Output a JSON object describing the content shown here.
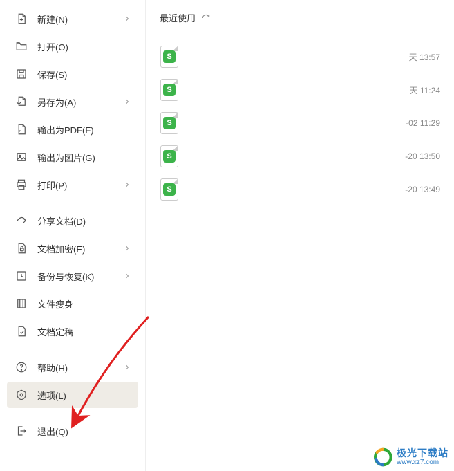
{
  "sidebar": {
    "items": [
      {
        "id": "new",
        "label": "新建(N)",
        "icon": "new-file-icon",
        "chevron": true
      },
      {
        "id": "open",
        "label": "打开(O)",
        "icon": "folder-open-icon",
        "chevron": false
      },
      {
        "id": "save",
        "label": "保存(S)",
        "icon": "save-icon",
        "chevron": false
      },
      {
        "id": "saveas",
        "label": "另存为(A)",
        "icon": "save-as-icon",
        "chevron": true
      },
      {
        "id": "exportpdf",
        "label": "输出为PDF(F)",
        "icon": "export-pdf-icon",
        "chevron": false
      },
      {
        "id": "exportimg",
        "label": "输出为图片(G)",
        "icon": "export-image-icon",
        "chevron": false
      },
      {
        "id": "print",
        "label": "打印(P)",
        "icon": "print-icon",
        "chevron": true
      },
      {
        "id": "share",
        "label": "分享文档(D)",
        "icon": "share-icon",
        "chevron": false
      },
      {
        "id": "encrypt",
        "label": "文档加密(E)",
        "icon": "lock-icon",
        "chevron": true
      },
      {
        "id": "backup",
        "label": "备份与恢复(K)",
        "icon": "backup-icon",
        "chevron": true
      },
      {
        "id": "slim",
        "label": "文件瘦身",
        "icon": "slim-icon",
        "chevron": false
      },
      {
        "id": "finalize",
        "label": "文档定稿",
        "icon": "finalize-icon",
        "chevron": false
      },
      {
        "id": "help",
        "label": "帮助(H)",
        "icon": "help-icon",
        "chevron": true
      },
      {
        "id": "options",
        "label": "选项(L)",
        "icon": "options-icon",
        "chevron": false,
        "selected": true
      },
      {
        "id": "exit",
        "label": "退出(Q)",
        "icon": "exit-icon",
        "chevron": false
      }
    ]
  },
  "recent": {
    "title": "最近使用",
    "files": [
      {
        "badge": "S",
        "time_suffix": "天 13:57"
      },
      {
        "badge": "S",
        "time_suffix": "天 11:24"
      },
      {
        "badge": "S",
        "time_suffix": "-02 11:29"
      },
      {
        "badge": "S",
        "time_suffix": "-20 13:50"
      },
      {
        "badge": "S",
        "time_suffix": "-20 13:49"
      }
    ]
  },
  "watermark": {
    "name": "极光下载站",
    "url": "www.xz7.com"
  }
}
